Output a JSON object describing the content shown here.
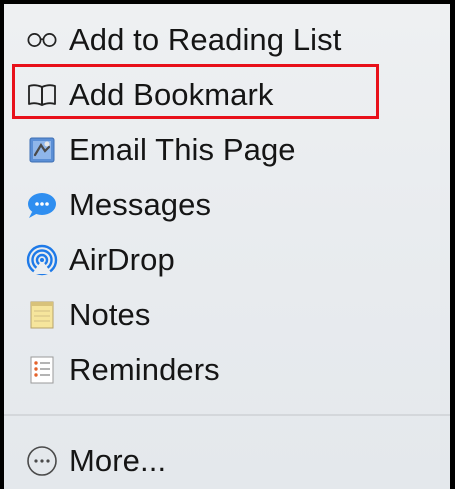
{
  "menu": {
    "items": [
      {
        "label": "Add to Reading List",
        "icon": "reading-glasses-icon"
      },
      {
        "label": "Add Bookmark",
        "icon": "open-book-icon",
        "highlighted": true
      },
      {
        "label": "Email This Page",
        "icon": "mail-stamp-icon"
      },
      {
        "label": "Messages",
        "icon": "messages-bubble-icon"
      },
      {
        "label": "AirDrop",
        "icon": "airdrop-icon"
      },
      {
        "label": "Notes",
        "icon": "notes-pad-icon"
      },
      {
        "label": "Reminders",
        "icon": "reminders-list-icon"
      }
    ],
    "more": {
      "label": "More...",
      "icon": "ellipsis-circle-icon"
    }
  },
  "colors": {
    "highlight_border": "#e8101a",
    "menu_background": "#ebeef1",
    "text": "#151515"
  }
}
